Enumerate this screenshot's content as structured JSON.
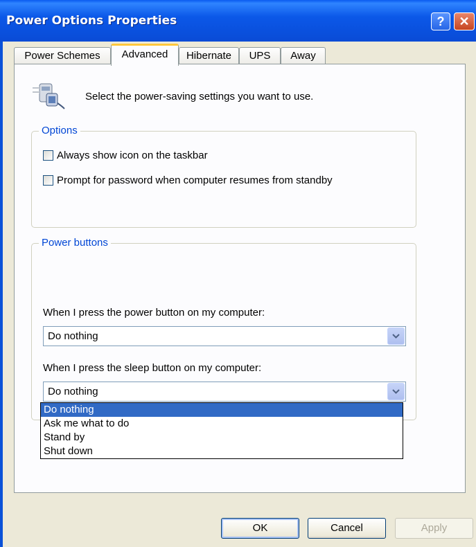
{
  "window": {
    "title": "Power Options Properties"
  },
  "titlebar": {
    "help_glyph": "?",
    "close_glyph": "✕"
  },
  "tabs": [
    {
      "label": "Power Schemes",
      "active": false
    },
    {
      "label": "Advanced",
      "active": true
    },
    {
      "label": "Hibernate",
      "active": false
    },
    {
      "label": "UPS",
      "active": false
    },
    {
      "label": "Away",
      "active": false
    }
  ],
  "header": {
    "text": "Select the power-saving settings you want to use.",
    "icon": "power-settings-icon"
  },
  "options_group": {
    "legend": "Options",
    "checkboxes": [
      {
        "label": "Always show icon on the taskbar",
        "checked": false
      },
      {
        "label": "Prompt for password when computer resumes from standby",
        "checked": false
      }
    ]
  },
  "power_buttons_group": {
    "legend": "Power buttons",
    "power_button_label": "When I press the power button on my computer:",
    "power_button_value": "Do nothing",
    "sleep_button_label": "When I press the sleep button on my computer:",
    "sleep_button_value": "Do nothing",
    "sleep_dropdown_open": true,
    "sleep_options": [
      "Do nothing",
      "Ask me what to do",
      "Stand by",
      "Shut down"
    ],
    "selected_option": "Do nothing"
  },
  "buttons": {
    "ok": "OK",
    "cancel": "Cancel",
    "apply": "Apply",
    "apply_enabled": false
  },
  "colors": {
    "title_bar": "#0b58e8",
    "group_legend": "#0046d5",
    "selection": "#316ac5",
    "active_tab_accent": "#ffc83c"
  }
}
